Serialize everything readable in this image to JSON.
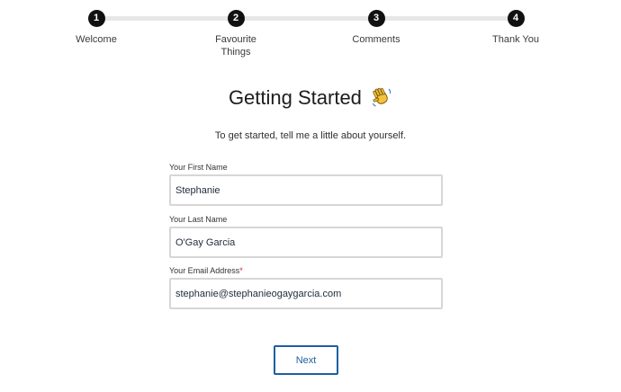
{
  "stepper": {
    "steps": [
      {
        "number": "1",
        "label": "Welcome"
      },
      {
        "number": "2",
        "label": "Favourite Things"
      },
      {
        "number": "3",
        "label": "Comments"
      },
      {
        "number": "4",
        "label": "Thank You"
      }
    ]
  },
  "heading": {
    "title": "Getting Started",
    "icon": "waving-hand-icon",
    "subtitle": "To get started, tell me a little about yourself."
  },
  "form": {
    "first_name": {
      "label": "Your First Name",
      "value": "Stephanie"
    },
    "last_name": {
      "label": "Your Last Name",
      "value": "O'Gay Garcia"
    },
    "email": {
      "label": "Your Email Address",
      "required_mark": "*",
      "value": "stephanie@stephanieogaygarcia.com"
    }
  },
  "actions": {
    "next_label": "Next"
  },
  "colors": {
    "step_circle": "#111111",
    "track": "#e7e7e7",
    "accent": "#1f5fa3",
    "required": "#d1202f",
    "input_border": "#d6d6d6"
  }
}
